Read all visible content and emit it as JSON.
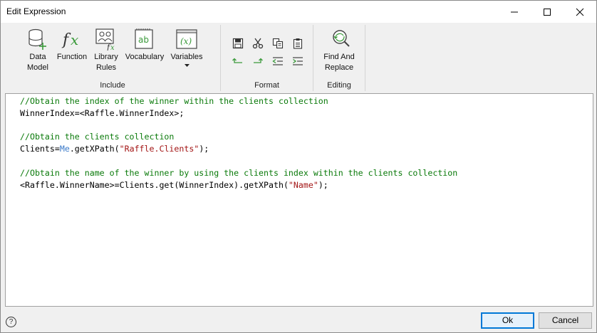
{
  "window": {
    "title": "Edit Expression"
  },
  "ribbon": {
    "include": {
      "label": "Include",
      "buttons": {
        "data_model": "Data\nModel",
        "function": "Function",
        "library_rules": "Library\nRules",
        "vocabulary": "Vocabulary",
        "variables": "Variables"
      }
    },
    "format": {
      "label": "Format"
    },
    "editing": {
      "label": "Editing",
      "find_replace": "Find And\nReplace"
    }
  },
  "editor": {
    "lines": [
      [
        {
          "t": "//Obtain the index of the winner within the clients collection",
          "c": "cm"
        }
      ],
      [
        {
          "t": "WinnerIndex=<Raffle.WinnerIndex>;",
          "c": ""
        }
      ],
      [],
      [
        {
          "t": "//Obtain the clients collection",
          "c": "cm"
        }
      ],
      [
        {
          "t": "Clients=",
          "c": ""
        },
        {
          "t": "Me",
          "c": "kw"
        },
        {
          "t": ".getXPath(",
          "c": ""
        },
        {
          "t": "\"Raffle.Clients\"",
          "c": "st"
        },
        {
          "t": ");",
          "c": ""
        }
      ],
      [],
      [
        {
          "t": "//Obtain the name of the winner by using the clients index within the clients collection",
          "c": "cm"
        }
      ],
      [
        {
          "t": "<Raffle.WinnerName>=Clients.get(WinnerIndex).getXPath(",
          "c": ""
        },
        {
          "t": "\"Name\"",
          "c": "st"
        },
        {
          "t": ");",
          "c": ""
        }
      ]
    ]
  },
  "footer": {
    "help": "?",
    "ok": "Ok",
    "cancel": "Cancel"
  },
  "colors": {
    "comment": "#0a7a0a",
    "keyword": "#3b7ac9",
    "string": "#a31515",
    "accent": "#0078d7"
  }
}
